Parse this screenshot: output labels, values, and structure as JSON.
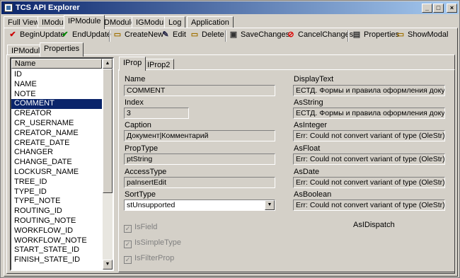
{
  "window": {
    "title": "TCS API Explorer"
  },
  "main_tabs": [
    "Full View",
    "IModule",
    "IPModule",
    "IDModule",
    "IGModule",
    "Log",
    "Application"
  ],
  "toolbar": {
    "begin_update": "BeginUpdate",
    "end_update": "EndUpdate",
    "create_new": "CreateNew",
    "edit": "Edit",
    "delete": "Delete",
    "save_changes": "SaveChanges",
    "cancel_changes": "CancelChanges",
    "properties": "Properties",
    "show_modal": "ShowModal"
  },
  "sub_tabs": [
    "IPModule",
    "Properties"
  ],
  "prop_tabs": [
    "IProp",
    "IProp2"
  ],
  "list": {
    "header": "Name",
    "rows": [
      "ID",
      "NAME",
      "NOTE",
      "COMMENT",
      "CREATOR",
      "CR_USERNAME",
      "CREATOR_NAME",
      "CREATE_DATE",
      "CHANGER",
      "CHANGE_DATE",
      "LOCKUSR_NAME",
      "TREE_ID",
      "TYPE_ID",
      "TYPE_NOTE",
      "ROUTING_ID",
      "ROUTING_NOTE",
      "WORKFLOW_ID",
      "WORKFLOW_NOTE",
      "START_STATE_ID",
      "FINISH_STATE_ID"
    ],
    "selected": "COMMENT"
  },
  "left_fields": {
    "name_label": "Name",
    "name_value": "COMMENT",
    "index_label": "Index",
    "index_value": "3",
    "caption_label": "Caption",
    "caption_value": "Документ|Комментарий",
    "proptype_label": "PropType",
    "proptype_value": "ptString",
    "accesstype_label": "AccessType",
    "accesstype_value": "paInsertEdit",
    "sorttype_label": "SortType",
    "sorttype_value": "stUnsupported"
  },
  "checkboxes": {
    "isfield": "IsField",
    "issimpletype": "IsSimpleType",
    "isfilterprop": "IsFilterProp"
  },
  "right_fields": {
    "displaytext_label": "DisplayText",
    "displaytext_value": "ЕСТД. Формы и правила оформления документов",
    "asstring_label": "AsString",
    "asstring_value": "ЕСТД. Формы и правила оформления документов",
    "asinteger_label": "AsInteger",
    "asinteger_value": "Err: Could not convert variant of type (OleStr) into type (",
    "asfloat_label": "AsFloat",
    "asfloat_value": "Err: Could not convert variant of type (OleStr) into type (",
    "asdate_label": "AsDate",
    "asdate_value": "Err: Could not convert variant of type (OleStr) into type (",
    "asboolean_label": "AsBoolean",
    "asboolean_value": "Err: Could not convert variant of type (OleStr) into type (",
    "isdispatch": "AsIDispatch"
  },
  "colors": {
    "title_start": "#0a246a",
    "title_end": "#a6caf0",
    "selection": "#0a246a",
    "face": "#d4d0c8"
  }
}
